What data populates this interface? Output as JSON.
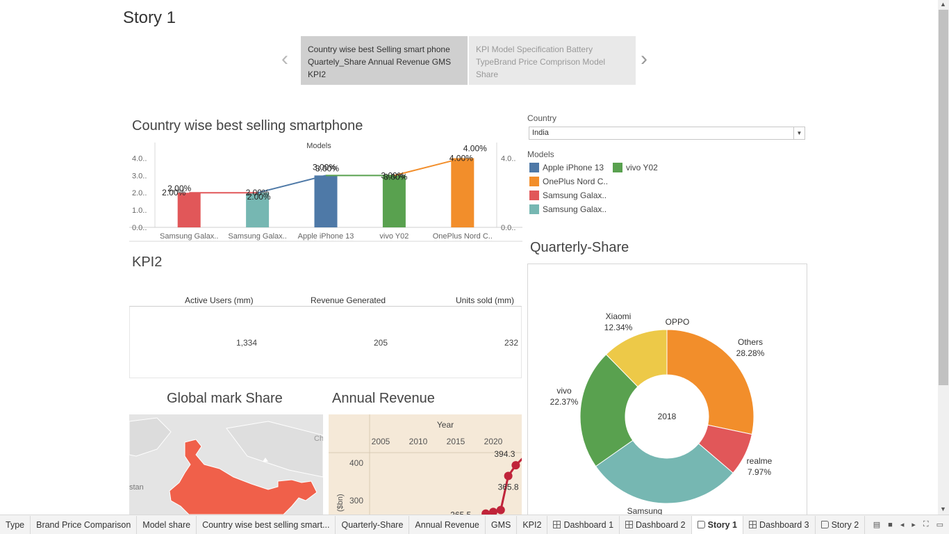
{
  "story": {
    "title": "Story 1",
    "points": [
      {
        "label": "Country wise best Selling smart phone Quartely_Share Annual Revenue GMS KPI2"
      },
      {
        "label": "KPI Model Specification Battery TypeBrand Price Comprison Model Share"
      }
    ],
    "prev_icon": "chevron-left-icon",
    "next_icon": "chevron-right-icon"
  },
  "bestselling": {
    "title": "Country wise best selling smartphone",
    "axis_header": "Models",
    "chart_data": {
      "type": "bar",
      "categories": [
        "Samsung Galax..",
        "Samsung Galax..",
        "Apple iPhone 13",
        "vivo Y02",
        "OnePlus Nord C.."
      ],
      "values": [
        2.0,
        2.0,
        3.0,
        3.0,
        4.0
      ],
      "line_values": [
        2.0,
        2.0,
        3.0,
        3.0,
        4.0
      ],
      "data_labels": [
        "2.00%",
        "2.00%",
        "3.00%",
        "3.00%",
        "4.00%"
      ],
      "line_labels": [
        "2.00%",
        "2.00%",
        "3.00%",
        "3.00%",
        "4.00%"
      ],
      "colors": [
        "#e15759",
        "#76b7b2",
        "#4e79a7",
        "#59a14f",
        "#f28e2b"
      ],
      "left_ticks": [
        "0.0..",
        "1.0..",
        "2.0..",
        "3.0..",
        "4.0.."
      ],
      "right_ticks": [
        "0.0..",
        "4.0.."
      ],
      "ylim": [
        0,
        4.3
      ],
      "grid": false
    }
  },
  "filters": {
    "country_label": "Country",
    "country_value": "India",
    "models_label": "Models",
    "legend": [
      {
        "label": "Apple iPhone 13",
        "color": "#4e79a7"
      },
      {
        "label": "vivo Y02",
        "color": "#59a14f"
      },
      {
        "label": "OnePlus Nord C..",
        "color": "#f28e2b"
      },
      {
        "label": "Samsung Galax..",
        "color": "#e15759"
      },
      {
        "label": "Samsung Galax..",
        "color": "#76b7b2"
      }
    ]
  },
  "kpi": {
    "title": "KPI2",
    "headers": [
      "Active Users (mm)",
      "Revenue Generated",
      "Units sold (mm)"
    ],
    "values": [
      "1,334",
      "205",
      "232"
    ]
  },
  "quarterly": {
    "title": "Quarterly-Share",
    "center_label": "2018",
    "chart_data": {
      "type": "pie",
      "slices": [
        {
          "name": "OPPO",
          "pct": "",
          "value": 0.0,
          "color": "#f28e2b"
        },
        {
          "name": "Others",
          "pct": "28.28%",
          "value": 28.28,
          "color": "#f28e2b"
        },
        {
          "name": "realme",
          "pct": "7.97%",
          "value": 7.97,
          "color": "#e15759"
        },
        {
          "name": "Samsung",
          "pct": "",
          "value": 29.04,
          "color": "#76b7b2"
        },
        {
          "name": "vivo",
          "pct": "22.37%",
          "value": 22.37,
          "color": "#59a14f"
        },
        {
          "name": "Xiaomi",
          "pct": "12.34%",
          "value": 12.34,
          "color": "#edc948"
        }
      ]
    }
  },
  "map": {
    "title": "Global mark Share",
    "labels": [
      "stan",
      "Ch"
    ],
    "land_color": "#f0604a"
  },
  "revenue": {
    "title": "Annual Revenue",
    "axis_header": "Year",
    "chart_data": {
      "type": "line",
      "x_ticks": [
        "2005",
        "2010",
        "2015",
        "2020"
      ],
      "y_ticks": [
        "400",
        "300"
      ],
      "ylabel": "($bn)",
      "points": [
        {
          "x": 2019,
          "y": 265.5,
          "label": "265.5"
        },
        {
          "x": 2020,
          "y": 270,
          "label": ""
        },
        {
          "x": 2021,
          "y": 275,
          "label": ""
        },
        {
          "x": 2022,
          "y": 365.8,
          "label": "365.8"
        },
        {
          "x": 2023,
          "y": 394.3,
          "label": "394.3"
        }
      ],
      "color": "#c0243a",
      "bg": "#f5e9d8"
    }
  },
  "tabs": [
    {
      "label": "Type",
      "icon": ""
    },
    {
      "label": "Brand Price Comparison",
      "icon": ""
    },
    {
      "label": "Model share",
      "icon": ""
    },
    {
      "label": "Country wise best selling smart...",
      "icon": ""
    },
    {
      "label": "Quarterly-Share",
      "icon": ""
    },
    {
      "label": "Annual Revenue",
      "icon": ""
    },
    {
      "label": "GMS",
      "icon": ""
    },
    {
      "label": "KPI2",
      "icon": ""
    },
    {
      "label": "Dashboard 1",
      "icon": "dashboard-icon"
    },
    {
      "label": "Dashboard 2",
      "icon": "dashboard-icon"
    },
    {
      "label": "Story 1",
      "icon": "story-icon",
      "active": true
    },
    {
      "label": "Dashboard 3",
      "icon": "dashboard-icon"
    },
    {
      "label": "Story 2",
      "icon": "story-icon"
    }
  ]
}
